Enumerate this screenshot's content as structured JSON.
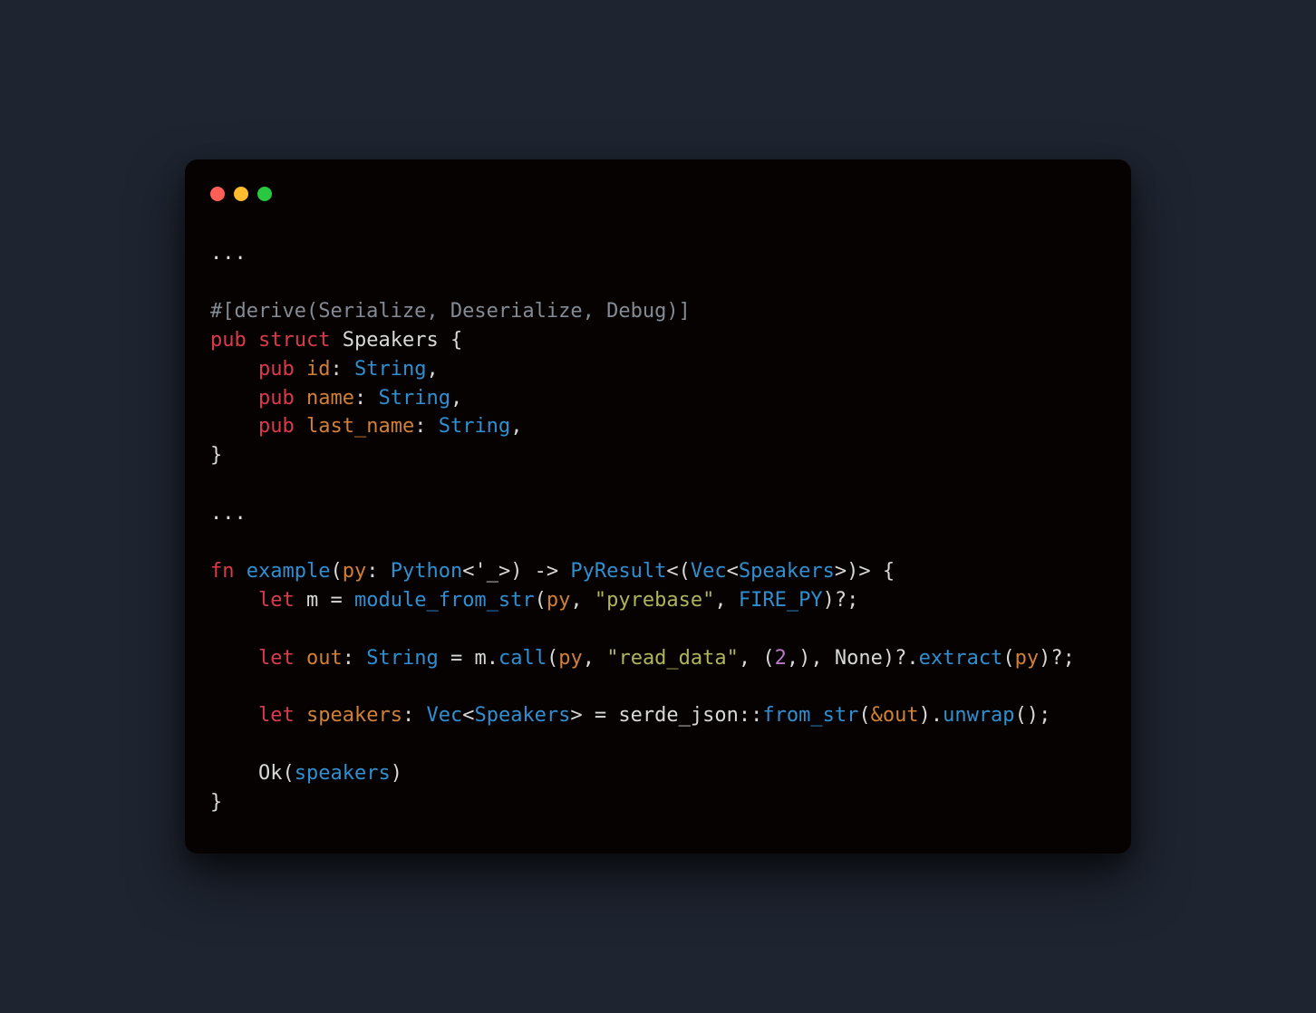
{
  "traffic_lights": {
    "red": "#ff5f57",
    "yellow": "#febc2e",
    "green": "#28c840"
  },
  "code": {
    "ellipsis1": "...",
    "derive_attr": "#[derive(Serialize, Deserialize, Debug)]",
    "kw_pub": "pub",
    "kw_struct": "struct",
    "struct_name": "Speakers",
    "brace_open": " {",
    "brace_close": "}",
    "field1_name": "id",
    "field2_name": "name",
    "field3_name": "last_name",
    "type_String": "String",
    "colon": ":",
    "comma": ",",
    "ellipsis2": "...",
    "kw_fn": "fn",
    "fn_name": "example",
    "param_py": "py",
    "type_Python": "Python",
    "lifetime": "<'_>",
    "arrow": " -> ",
    "type_PyResult": "PyResult",
    "lt": "<",
    "gt": ">",
    "paren_open": "(",
    "paren_close": ")",
    "type_Vec": "Vec",
    "type_Speakers": "Speakers",
    "kw_let": "let",
    "var_m": "m",
    "eq": " = ",
    "fn_module_from_str": "module_from_str",
    "str_pyrebase": "\"pyrebase\"",
    "const_FIRE_PY": "FIRE_PY",
    "qmark_semi": "?;",
    "var_out": "out",
    "dot": ".",
    "fn_call": "call",
    "str_read_data": "\"read_data\"",
    "num_2": "2",
    "none": "None",
    "fn_extract": "extract",
    "var_speakers": "speakers",
    "path_serde_json": "serde_json",
    "dcolon": "::",
    "fn_from_str": "from_str",
    "amp_out": "&out",
    "fn_unwrap": "unwrap",
    "empty_args": "()",
    "semi": ";",
    "Ok": "Ok",
    "indent": "    ",
    "indent2": "        "
  }
}
